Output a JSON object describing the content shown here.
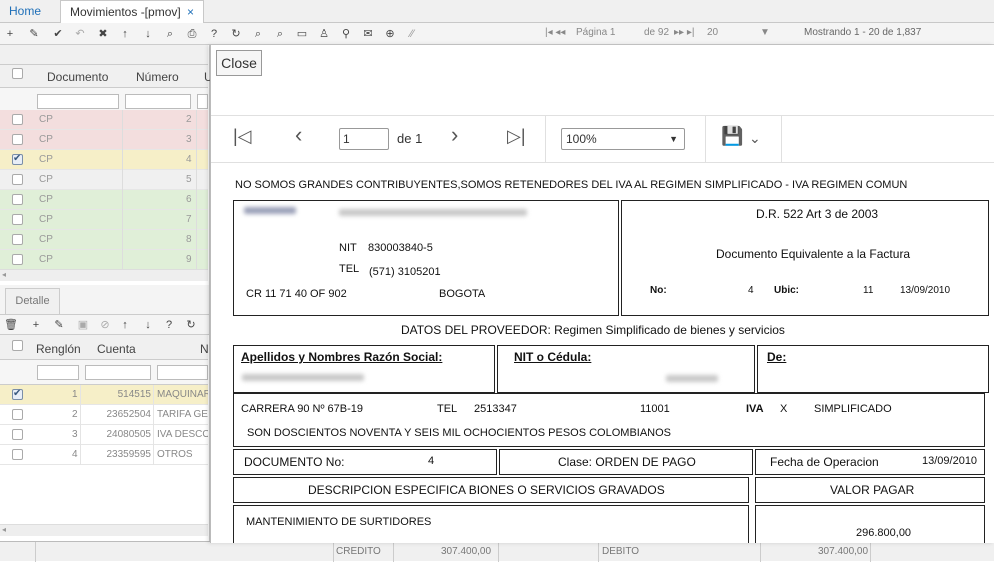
{
  "tabs": {
    "home": "Home",
    "movimientos": "Movimientos -[pmov]",
    "close": "×"
  },
  "toolbar": {
    "pagina_label": "Página 1",
    "de_label": "de 92",
    "page_size": "20",
    "mostrando": "Mostrando 1 - 20 de 1,837"
  },
  "grid_top": {
    "headers": {
      "documento": "Documento",
      "numero": "Número",
      "col3": "U"
    },
    "rows": [
      {
        "doc": "CP",
        "num": "2",
        "checked": false,
        "color": "#f3dede"
      },
      {
        "doc": "CP",
        "num": "3",
        "checked": false,
        "color": "#f3dede"
      },
      {
        "doc": "CP",
        "num": "4",
        "checked": true,
        "color": "#f6efc8"
      },
      {
        "doc": "CP",
        "num": "5",
        "checked": false,
        "color": "#f0f0f0"
      },
      {
        "doc": "CP",
        "num": "6",
        "checked": false,
        "color": "#e0efd8"
      },
      {
        "doc": "CP",
        "num": "7",
        "checked": false,
        "color": "#e0efd8"
      },
      {
        "doc": "CP",
        "num": "8",
        "checked": false,
        "color": "#e0efd8"
      },
      {
        "doc": "CP",
        "num": "9",
        "checked": false,
        "color": "#e0efd8"
      }
    ]
  },
  "detalle": {
    "tab": "Detalle",
    "headers": {
      "renglon": "Renglón",
      "cuenta": "Cuenta",
      "col3": "N"
    },
    "rows": [
      {
        "renglon": "1",
        "cuenta": "514515",
        "nombre": "MAQUINARIA",
        "checked": true
      },
      {
        "renglon": "2",
        "cuenta": "23652504",
        "nombre": "TARIFA GE",
        "checked": false
      },
      {
        "renglon": "3",
        "cuenta": "24080505",
        "nombre": "IVA DESCO",
        "checked": false
      },
      {
        "renglon": "4",
        "cuenta": "23359595",
        "nombre": "OTROS",
        "checked": false
      }
    ]
  },
  "footer": {
    "credito_label": "CREDITO",
    "credito_value": "307.400,00",
    "debito_label": "DEBITO",
    "debito_value": "307.400,00"
  },
  "modal": {
    "close_label": "Close",
    "page_value": "1",
    "page_of": "de 1",
    "zoom": "100%"
  },
  "report": {
    "header_line": "NO SOMOS GRANDES CONTRIBUYENTES,SOMOS RETENEDORES DEL IVA AL REGIMEN SIMPLIFICADO - IVA REGIMEN COMUN",
    "nit_label": "NIT",
    "nit_value": "830003840-5",
    "tel_label": "TEL",
    "tel_value": "(571) 3105201",
    "address": "CR 11 71 40 OF 902",
    "city": "BOGOTA",
    "dr_title": "D.R. 522 Art 3 de 2003",
    "doc_equiv": "Documento Equivalente a la Factura",
    "no_label": "No:",
    "no_value": "4",
    "ubic_label": "Ubic:",
    "ubic_value": "11",
    "fecha": "13/09/2010",
    "proveedor_title": "DATOS DEL PROVEEDOR: Regimen Simplificado de bienes y servicios",
    "apellidos_label": "Apellidos y Nombres Razón Social:",
    "nit_cedula_label": "NIT o Cédula:",
    "de_label": "De:",
    "prov_address": "CARRERA 90 Nº 67B-19",
    "prov_tel_label": "TEL",
    "prov_tel": "2513347",
    "prov_code": "11001",
    "iva_label": "IVA",
    "iva_mark": "X",
    "regimen": "SIMPLIFICADO",
    "son": "SON  DOSCIENTOS NOVENTA Y SEIS  MIL OCHOCIENTOS  PESOS COLOMBIANOS",
    "documento_no_label": "DOCUMENTO No:",
    "documento_no_value": "4",
    "clase": "Clase: ORDEN DE PAGO",
    "fecha_op_label": "Fecha de Operacion",
    "fecha_op_value": "13/09/2010",
    "desc_header": "DESCRIPCION ESPECIFICA BIONES O SERVICIOS GRAVADOS",
    "valor_header": "VALOR PAGAR",
    "item_desc": "MANTENIMIENTO DE SURTIDORES",
    "item_value": "296.800,00"
  }
}
